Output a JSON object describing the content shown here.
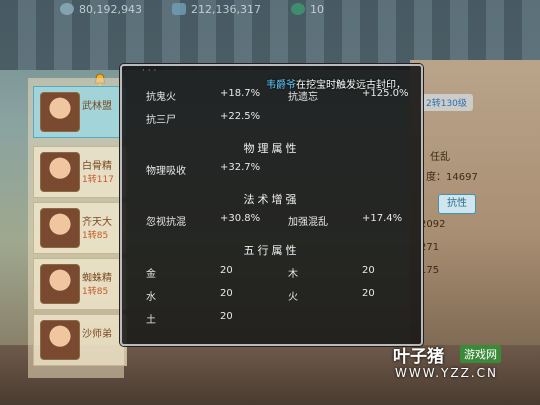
{
  "topbar": {
    "currency1": "80,192,943",
    "currency2": "212,136,317",
    "currency3": "10"
  },
  "party": [
    {
      "name": "武林盟",
      "level": "",
      "active": true
    },
    {
      "name": "白骨精",
      "level": "1转117",
      "active": false
    },
    {
      "name": "齐天大",
      "level": "1转85",
      "active": false
    },
    {
      "name": "蜘蛛精",
      "level": "1转85",
      "active": false
    },
    {
      "name": "沙师弟",
      "level": "",
      "active": false
    }
  ],
  "right_panel": {
    "level_badge": "2转130级",
    "status": "任乱",
    "stat_label": "度：14697",
    "attr_button": "抗性",
    "v1": "2092",
    "v2": "271",
    "v3": "175"
  },
  "notice": {
    "who": "韦爵爷",
    "text": "在挖宝时触发远古封印，"
  },
  "tooltip": {
    "top_faded": "· · ·",
    "rows_top": [
      {
        "label": "抗鬼火",
        "value": "+18.7%",
        "label2": "抗遗忘",
        "value2": "+125.0%"
      },
      {
        "label": "抗三尸",
        "value": "+22.5%"
      }
    ],
    "section_physical": "物理属性",
    "physical": [
      {
        "label": "物理吸收",
        "value": "+32.7%"
      }
    ],
    "section_magic": "法术增强",
    "magic": [
      {
        "label": "忽视抗混",
        "value": "+30.8%",
        "label2": "加强混乱",
        "value2": "+17.4%"
      }
    ],
    "section_elements": "五行属性",
    "elements": [
      {
        "label": "金",
        "value": "20",
        "label2": "木",
        "value2": "20"
      },
      {
        "label": "水",
        "value": "20",
        "label2": "火",
        "value2": "20"
      },
      {
        "label": "土",
        "value": "20"
      }
    ]
  },
  "watermark": {
    "main": "叶子猪",
    "sub": "游戏网",
    "url": "WWW.YZZ.CN"
  }
}
